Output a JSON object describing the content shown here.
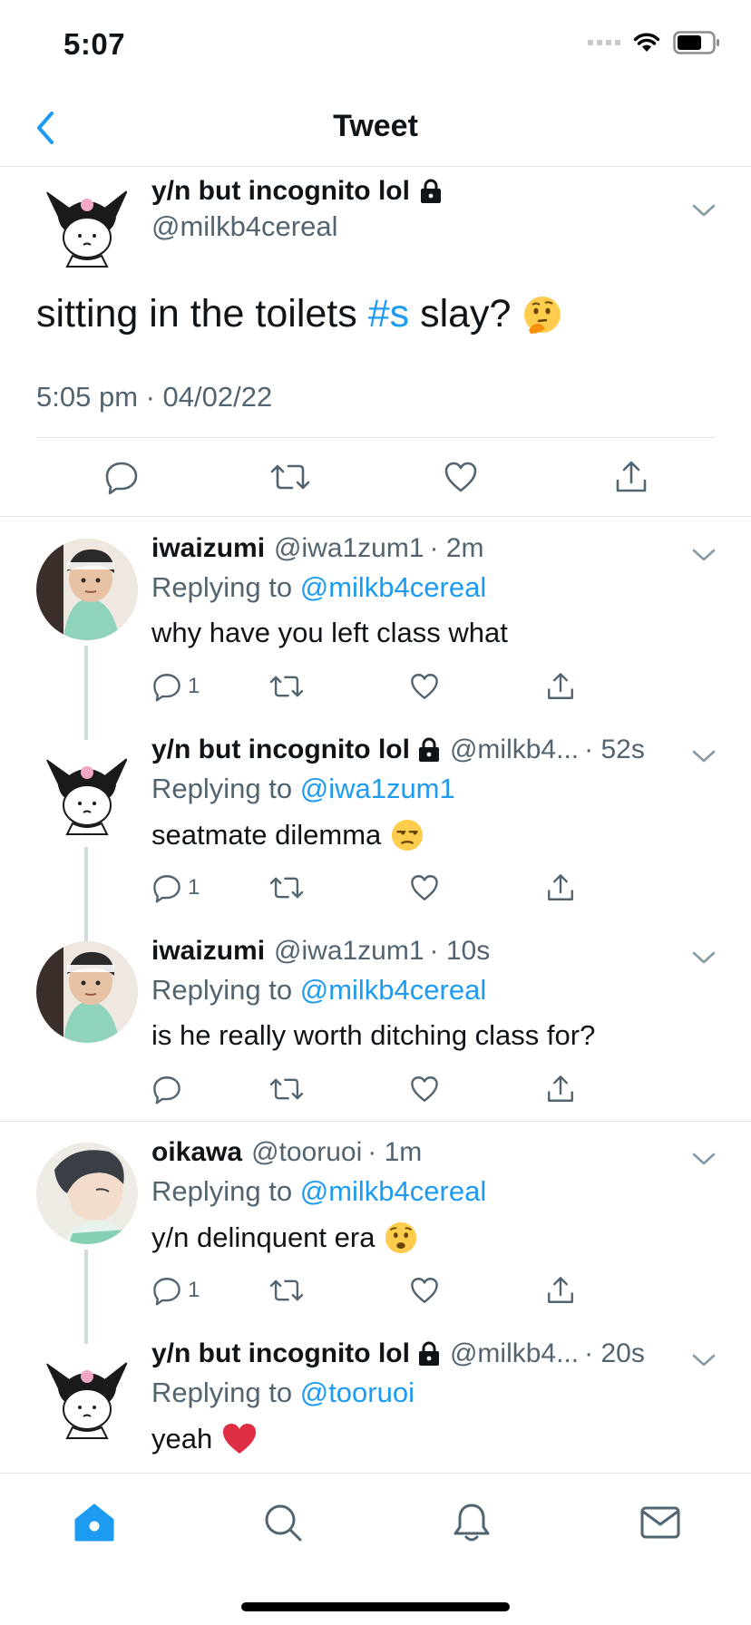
{
  "status_bar": {
    "time": "5:07"
  },
  "nav": {
    "title": "Tweet"
  },
  "main_tweet": {
    "name": "y/n but incognito lol",
    "handle": "@milkb4cereal",
    "text_before": "sitting in the toilets ",
    "hashtag": "#s",
    "text_after": " slay?",
    "timestamp": "5:05 pm · 04/02/22"
  },
  "replies": [
    {
      "name": "iwaizumi",
      "handle": "@iwa1zum1",
      "time": "· 2m",
      "replying_prefix": "Replying to ",
      "replying_to": "@milkb4cereal",
      "text": "why have you left class what",
      "reply_count": "1"
    },
    {
      "name": "y/n but incognito lol",
      "handle": "@milkb4...",
      "time": "· 52s",
      "replying_prefix": "Replying to ",
      "replying_to": "@iwa1zum1",
      "text": "seatmate dilemma",
      "reply_count": "1"
    },
    {
      "name": "iwaizumi",
      "handle": "@iwa1zum1",
      "time": "· 10s",
      "replying_prefix": "Replying to ",
      "replying_to": "@milkb4cereal",
      "text": "is he really worth ditching class for?",
      "reply_count": ""
    },
    {
      "name": "oikawa",
      "handle": "@tooruoi",
      "time": "· 1m",
      "replying_prefix": "Replying to ",
      "replying_to": "@milkb4cereal",
      "text": "y/n delinquent era",
      "reply_count": "1"
    },
    {
      "name": "y/n but incognito lol",
      "handle": "@milkb4...",
      "time": "· 20s",
      "replying_prefix": "Replying to ",
      "replying_to": "@tooruoi",
      "text": "yeah",
      "reply_count": ""
    }
  ],
  "tabbar": {
    "items": [
      "home-icon",
      "search-icon",
      "notifications-icon",
      "messages-icon"
    ],
    "active": "home-icon"
  },
  "colors": {
    "accent": "#1d9bf0",
    "secondary_text": "#536471",
    "divider": "#dfe3e6",
    "heart_emoji": "#e0245e"
  }
}
